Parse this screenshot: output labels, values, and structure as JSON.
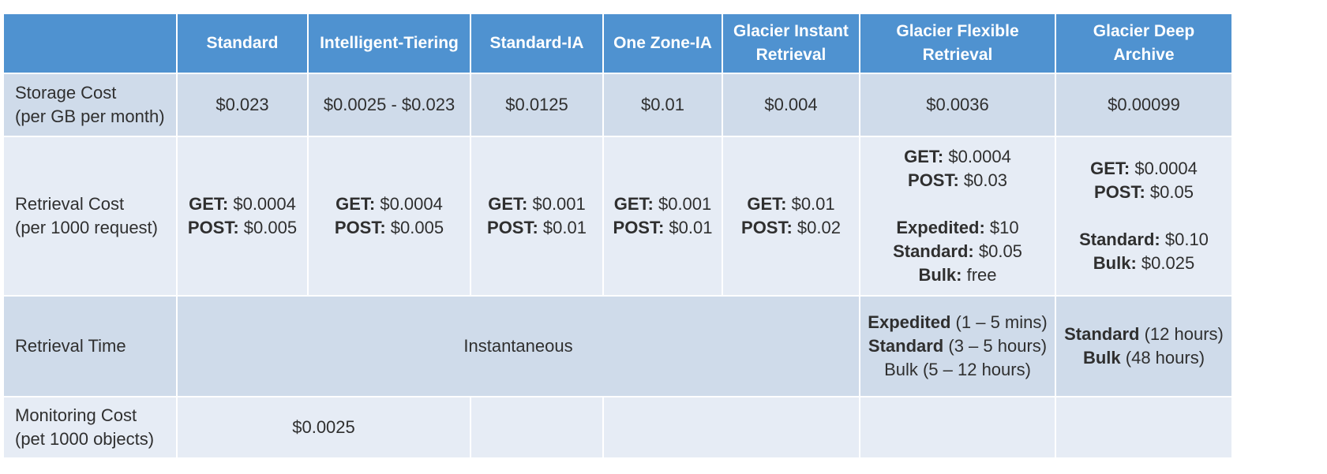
{
  "columns": [
    "Standard",
    "Intelligent-Tiering",
    "Standard-IA",
    "One Zone-IA",
    "Glacier Instant Retrieval",
    "Glacier Flexible Retrieval",
    "Glacier Deep Archive"
  ],
  "header_lines": [
    [
      "Standard"
    ],
    [
      "Intelligent-Tiering"
    ],
    [
      "Standard-IA"
    ],
    [
      "One Zone-IA"
    ],
    [
      "Glacier Instant",
      "Retrieval"
    ],
    [
      "Glacier Flexible",
      "Retrieval"
    ],
    [
      "Glacier Deep",
      "Archive"
    ]
  ],
  "rows": {
    "storage_cost": {
      "label_lines": [
        "Storage Cost",
        "(per GB per month)"
      ],
      "values": [
        "$0.023",
        "$0.0025 - $0.023",
        "$0.0125",
        "$0.01",
        "$0.004",
        "$0.0036",
        "$0.00099"
      ]
    },
    "retrieval_cost": {
      "label_lines": [
        "Retrieval Cost",
        "(per 1000 request)"
      ],
      "cells": [
        [
          {
            "k": "GET:",
            "v": " $0.0004"
          },
          {
            "k": "POST:",
            "v": " $0.005"
          }
        ],
        [
          {
            "k": "GET:",
            "v": " $0.0004"
          },
          {
            "k": "POST:",
            "v": " $0.005"
          }
        ],
        [
          {
            "k": "GET:",
            "v": " $0.001"
          },
          {
            "k": "POST:",
            "v": " $0.01"
          }
        ],
        [
          {
            "k": "GET:",
            "v": " $0.001"
          },
          {
            "k": "POST:",
            "v": " $0.01"
          }
        ],
        [
          {
            "k": "GET:",
            "v": " $0.01"
          },
          {
            "k": "POST:",
            "v": " $0.02"
          }
        ],
        [
          {
            "k": "GET:",
            "v": " $0.0004"
          },
          {
            "k": "POST:",
            "v": " $0.03"
          },
          {
            "gap": true
          },
          {
            "k": "Expedited:",
            "v": " $10"
          },
          {
            "k": "Standard:",
            "v": " $0.05"
          },
          {
            "k": "Bulk:",
            "v": " free"
          }
        ],
        [
          {
            "k": "GET:",
            "v": " $0.0004"
          },
          {
            "k": "POST:",
            "v": " $0.05"
          },
          {
            "gap": true
          },
          {
            "k": "Standard:",
            "v": " $0.10"
          },
          {
            "k": "Bulk:",
            "v": " $0.025"
          }
        ]
      ]
    },
    "retrieval_time": {
      "label": "Retrieval Time",
      "instant": "Instantaneous",
      "flexible": [
        {
          "k": "Expedited",
          "v": " (1 – 5 mins)"
        },
        {
          "k": "Standard",
          "v": " (3 – 5 hours)"
        },
        {
          "k": "",
          "v": "Bulk (5 – 12 hours)"
        }
      ],
      "deep": [
        {
          "k": "Standard",
          "v": " (12 hours)"
        },
        {
          "k": "Bulk",
          "v": " (48 hours)"
        }
      ]
    },
    "monitoring_cost": {
      "label_lines": [
        "Monitoring Cost",
        "(pet 1000 objects)"
      ],
      "value": "$0.0025"
    }
  },
  "colors": {
    "header": "#4f92d0",
    "row_dark": "#cfdbea",
    "row_light": "#e6ecf5"
  }
}
